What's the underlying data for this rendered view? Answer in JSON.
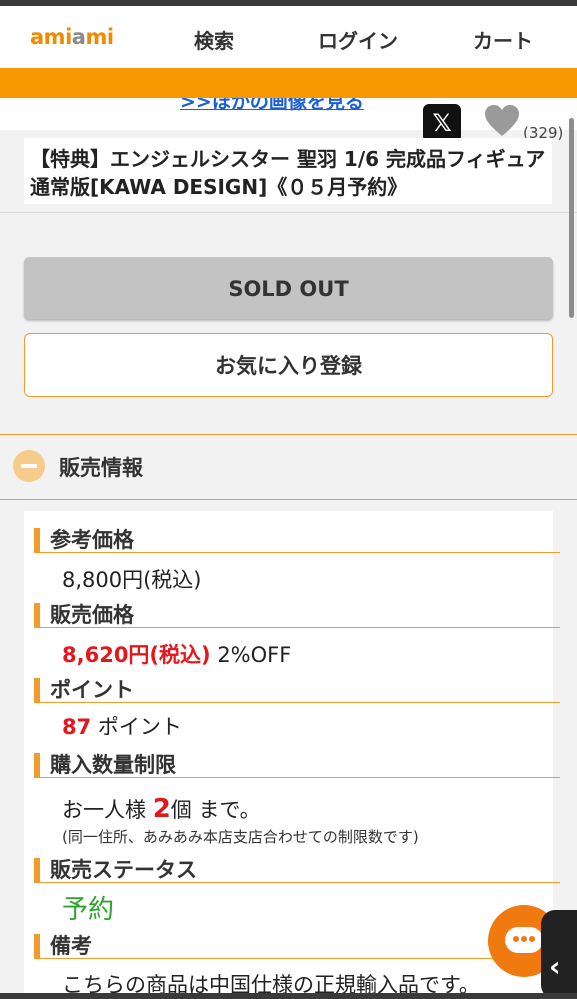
{
  "header": {
    "logo": "amiami",
    "nav": [
      "検索",
      "ログイン",
      "カート"
    ]
  },
  "product": {
    "more_images_link": ">>ほかの画像を見る",
    "x_label": "𝕏",
    "like_count": "(329)",
    "title": "【特典】エンジェルシスター 聖羽 1/6 完成品フィギュア 通常版[KAWA DESIGN]《０５月予約》",
    "soldout_label": "SOLD OUT",
    "favorite_label": "お気に入り登録"
  },
  "sales_info": {
    "section_title": "販売情報",
    "ref_price_label": "参考価格",
    "ref_price": "8,800円(税込)",
    "sale_price_label": "販売価格",
    "sale_price": "8,620円(税込)",
    "discount": "2%OFF",
    "points_label": "ポイント",
    "points_value": "87",
    "points_unit": "ポイント",
    "limit_label": "購入数量制限",
    "limit_prefix": "お一人様",
    "limit_count": "2",
    "limit_suffix": "個 まで。",
    "limit_note": "(同一住所、あみあみ本店支店合わせての制限数です)",
    "status_label": "販売ステータス",
    "status_value": "予約",
    "remarks_label": "備考",
    "remarks_text": "こちらの商品は中国仕様の正規輸入品です。"
  },
  "colors": {
    "accent": "#f79800",
    "price_red": "#e3181d",
    "status_green": "#2da52d"
  }
}
